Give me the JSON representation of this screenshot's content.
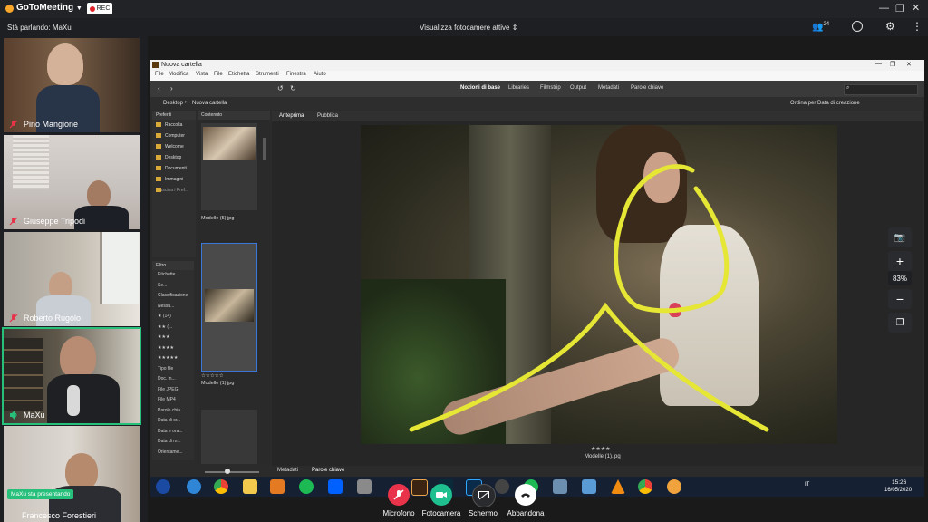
{
  "app": {
    "brand": "GoToMeeting",
    "rec_label": "REC"
  },
  "header": {
    "speaking": "Stà parlando: MaXu",
    "active_cameras": "Visualizza fotocamere attive",
    "participants_count": "24"
  },
  "participants": [
    {
      "name": "Pino Mangione",
      "mic": "muted"
    },
    {
      "name": "Giuseppe Tripodi",
      "mic": "muted"
    },
    {
      "name": "Roberto Rugolo",
      "mic": "muted"
    },
    {
      "name": "MaXu",
      "mic": "active"
    },
    {
      "name": "Francesco Forestieri",
      "mic": "muted"
    }
  ],
  "presenting_badge": "MaXu sta presentando",
  "app_window": {
    "title": "Nuova cartella",
    "menu": [
      "File",
      "Modifica",
      "Vista",
      "File",
      "Etichetta",
      "Strumenti",
      "Finestra",
      "Aiuto"
    ],
    "workspace_tabs": [
      "Nozioni di base",
      "Libraries",
      "Filmstrip",
      "Output",
      "Metadati",
      "Parole chiave"
    ],
    "path": [
      "Desktop",
      "Nuova cartella"
    ],
    "sort_label": "Ordina per Data di creazione",
    "favorites_header": "Preferiti",
    "favorites": [
      "Raccolta",
      "Computer",
      "Welcome",
      "Desktop",
      "Documenti",
      "Immagini"
    ],
    "favorites_hint": "Trascina i Pref...",
    "content_header": "Contenuto",
    "preview_tabs": [
      "Anteprima",
      "Pubblica"
    ],
    "thumbnails": [
      {
        "filename": "Modelle (5).jpg"
      },
      {
        "filename": "Modelle (1).jpg",
        "stars": "☆☆☆☆☆"
      }
    ],
    "filter_header": "Filtro",
    "filter_items": [
      "Etichette",
      "Se...",
      "Classificazione",
      "Nessu...",
      "★ (14)",
      "★★ (...",
      "★★★",
      "★★★★",
      "★★★★★",
      "Tipo file",
      "Doc. in...",
      "File JPEG",
      "File MP4",
      "Parole chia...",
      "Data di cr...",
      "Data e ora...",
      "Data di m...",
      "Orientame..."
    ],
    "bottom_tabs": [
      "Metadati",
      "Parole chiave"
    ],
    "preview_caption_stars": "★★★★",
    "preview_caption_file": "Modelle (1).jpg"
  },
  "taskbar": {
    "lang": "IT",
    "time": "15:26",
    "date": "16/05/2020"
  },
  "zoom": {
    "level": "83%"
  },
  "controls": [
    {
      "label": "Microfono",
      "color": "#e8334a"
    },
    {
      "label": "Fotocamera",
      "color": "#1fbf8f"
    },
    {
      "label": "Schermo",
      "color": "#2a2b2e"
    },
    {
      "label": "Abbandona",
      "color": "#ffffff"
    }
  ]
}
